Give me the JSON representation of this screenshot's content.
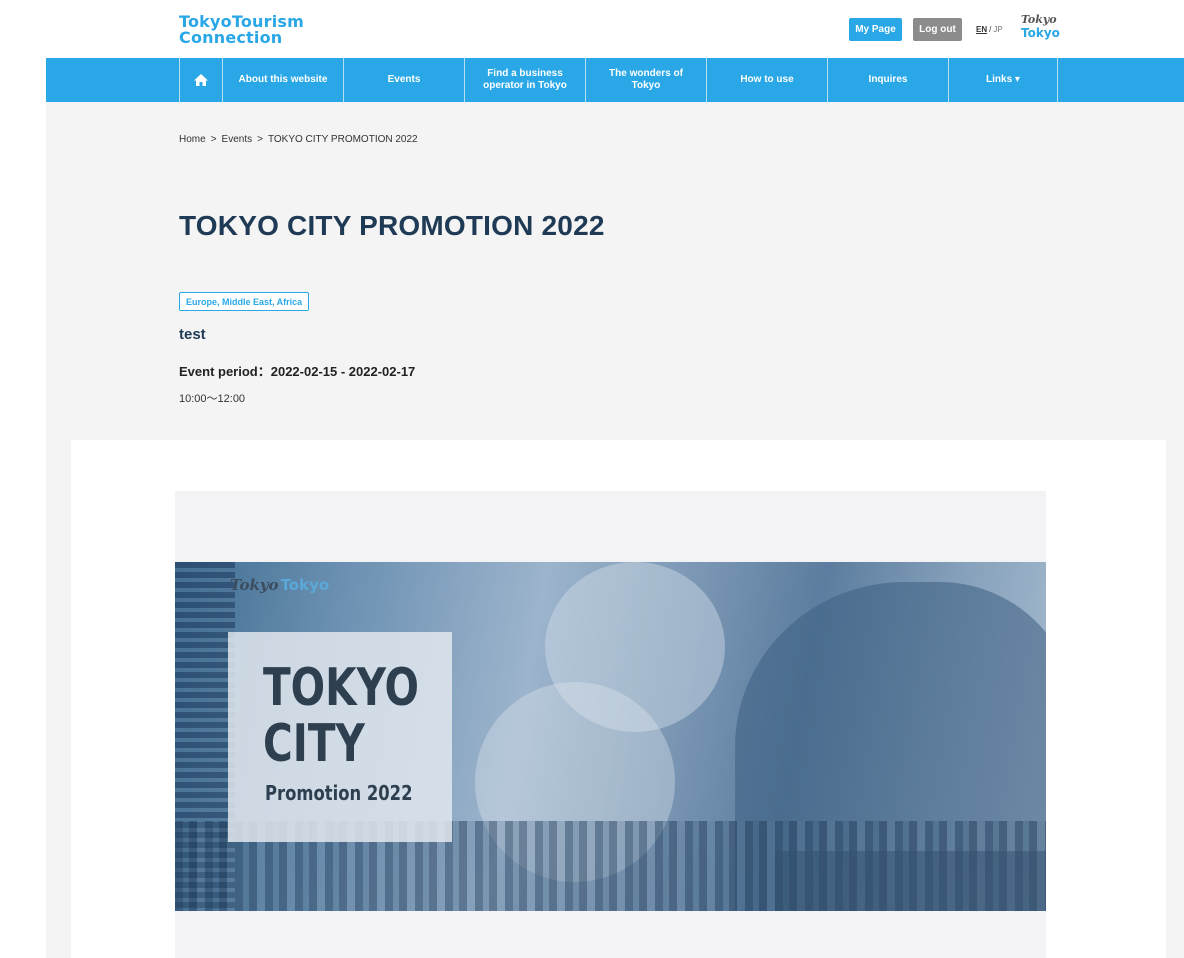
{
  "header": {
    "logo_line1": "TokyoTourism",
    "logo_line2": "Connection",
    "mypage_label": "My Page",
    "logout_label": "Log out",
    "lang_en": "EN",
    "lang_sep": "/",
    "lang_jp": "JP",
    "brand_logo_line1": "Tokyo",
    "brand_logo_line2": "Tokyo"
  },
  "nav": {
    "items": [
      {
        "label": "About this website"
      },
      {
        "label": "Events"
      },
      {
        "label": "Find a business operator in Tokyo"
      },
      {
        "label": "The wonders of Tokyo"
      },
      {
        "label": "How to use"
      },
      {
        "label": "Inquires"
      },
      {
        "label": "Links ▾"
      }
    ]
  },
  "breadcrumb": {
    "home": "Home",
    "sep": ">",
    "events": "Events",
    "current": "TOKYO CITY PROMOTION 2022"
  },
  "event": {
    "title": "TOKYO CITY PROMOTION 2022",
    "region_tag": "Europe, Middle East, Africa",
    "subtitle": "test",
    "period": "Event period：2022-02-15 - 2022-02-17",
    "time": "10:00〜12:00"
  },
  "banner": {
    "logo_a": "Tokyo",
    "logo_b": "Tokyo",
    "line1": "TOKYO",
    "line2": "CITY",
    "line3": "Promotion 2022"
  },
  "colors": {
    "accent": "#29a7e6",
    "title": "#1f3a55",
    "logout_bg": "#8c8c8c",
    "content_bg": "#f4f4f4"
  }
}
